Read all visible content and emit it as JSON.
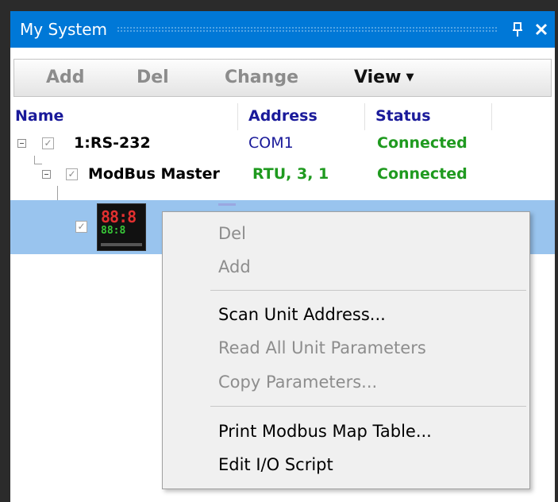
{
  "window": {
    "title": "My System",
    "pin_glyph": "q",
    "close_glyph": "✕",
    "colors": {
      "titlebar": "#0078d7",
      "selection": "#99c4ee",
      "connected": "#1f9a1f",
      "header": "#1a1a9a"
    }
  },
  "toolbar": {
    "add_label": "Add",
    "del_label": "Del",
    "change_label": "Change",
    "view_label": "View",
    "view_caret": "▼"
  },
  "columns": {
    "name": "Name",
    "address": "Address",
    "status": "Status"
  },
  "tree": {
    "port": {
      "name": "1:RS-232",
      "address": "COM1",
      "status": "Connected",
      "check": "✓"
    },
    "master": {
      "name": "ModBus Master",
      "address": "RTU, 3, 1",
      "status": "Connected",
      "check": "✓"
    },
    "device": {
      "check": "✓",
      "icon": "temperature-controller-icon"
    }
  },
  "context_menu": {
    "items": [
      {
        "label": "Del",
        "enabled": false
      },
      {
        "label": "Add",
        "enabled": false
      },
      {
        "label": "Scan Unit Address...",
        "enabled": true
      },
      {
        "label": "Read All Unit Parameters",
        "enabled": false
      },
      {
        "label": "Copy Parameters...",
        "enabled": false
      },
      {
        "label": "Print Modbus Map Table...",
        "enabled": true
      },
      {
        "label": "Edit I/O Script",
        "enabled": true
      }
    ]
  }
}
